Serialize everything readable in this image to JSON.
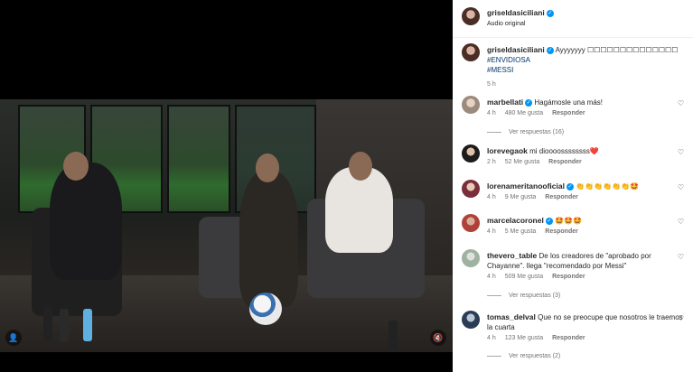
{
  "header": {
    "username": "griseldasiciliani",
    "audio": "Audio original"
  },
  "caption": {
    "username": "griseldasiciliani",
    "text": "Ayyyyyyy ☐☐☐☐☐☐☐☐☐☐☐☐☐☐",
    "hashtag1": "#ENVIDIOSA",
    "hashtag2": "#MESSI",
    "time": "5 h"
  },
  "comments": [
    {
      "username": "marbellati",
      "verified": true,
      "text": "Hagámosle una más!",
      "time": "4 h",
      "likes": "480 Me gusta",
      "reply": "Responder",
      "view_replies": "Ver respuestas (16)"
    },
    {
      "username": "lorevegaok",
      "verified": false,
      "text": "mi dioooossssssss❤️",
      "time": "2 h",
      "likes": "52 Me gusta",
      "reply": "Responder"
    },
    {
      "username": "lorenameritanooficial",
      "verified": true,
      "text": "👏👏👏👏👏👏🤩",
      "time": "4 h",
      "likes": "9 Me gusta",
      "reply": "Responder"
    },
    {
      "username": "marcelacoronel",
      "verified": true,
      "text": "🤩🤩🤩",
      "time": "4 h",
      "likes": "5 Me gusta",
      "reply": "Responder"
    },
    {
      "username": "thevero_table",
      "verified": false,
      "text": "De los creadores de \"aprobado por Chayanne\". llega \"recomendado por Messi\"",
      "time": "4 h",
      "likes": "509 Me gusta",
      "reply": "Responder",
      "view_replies": "Ver respuestas (3)"
    },
    {
      "username": "tomas_delval",
      "verified": false,
      "text": "Que no se preocupe que nosotros le traemos la cuarta",
      "time": "4 h",
      "likes": "123 Me gusta",
      "reply": "Responder",
      "view_replies": "Ver respuestas (2)"
    }
  ],
  "icons": {
    "verified": "verified-badge-icon",
    "heart": "heart-icon",
    "mute": "mute-icon",
    "tag": "user-tag-icon"
  },
  "colors": {
    "verified": "#0095f6",
    "hashtag": "#00376b",
    "meta": "#737373"
  }
}
